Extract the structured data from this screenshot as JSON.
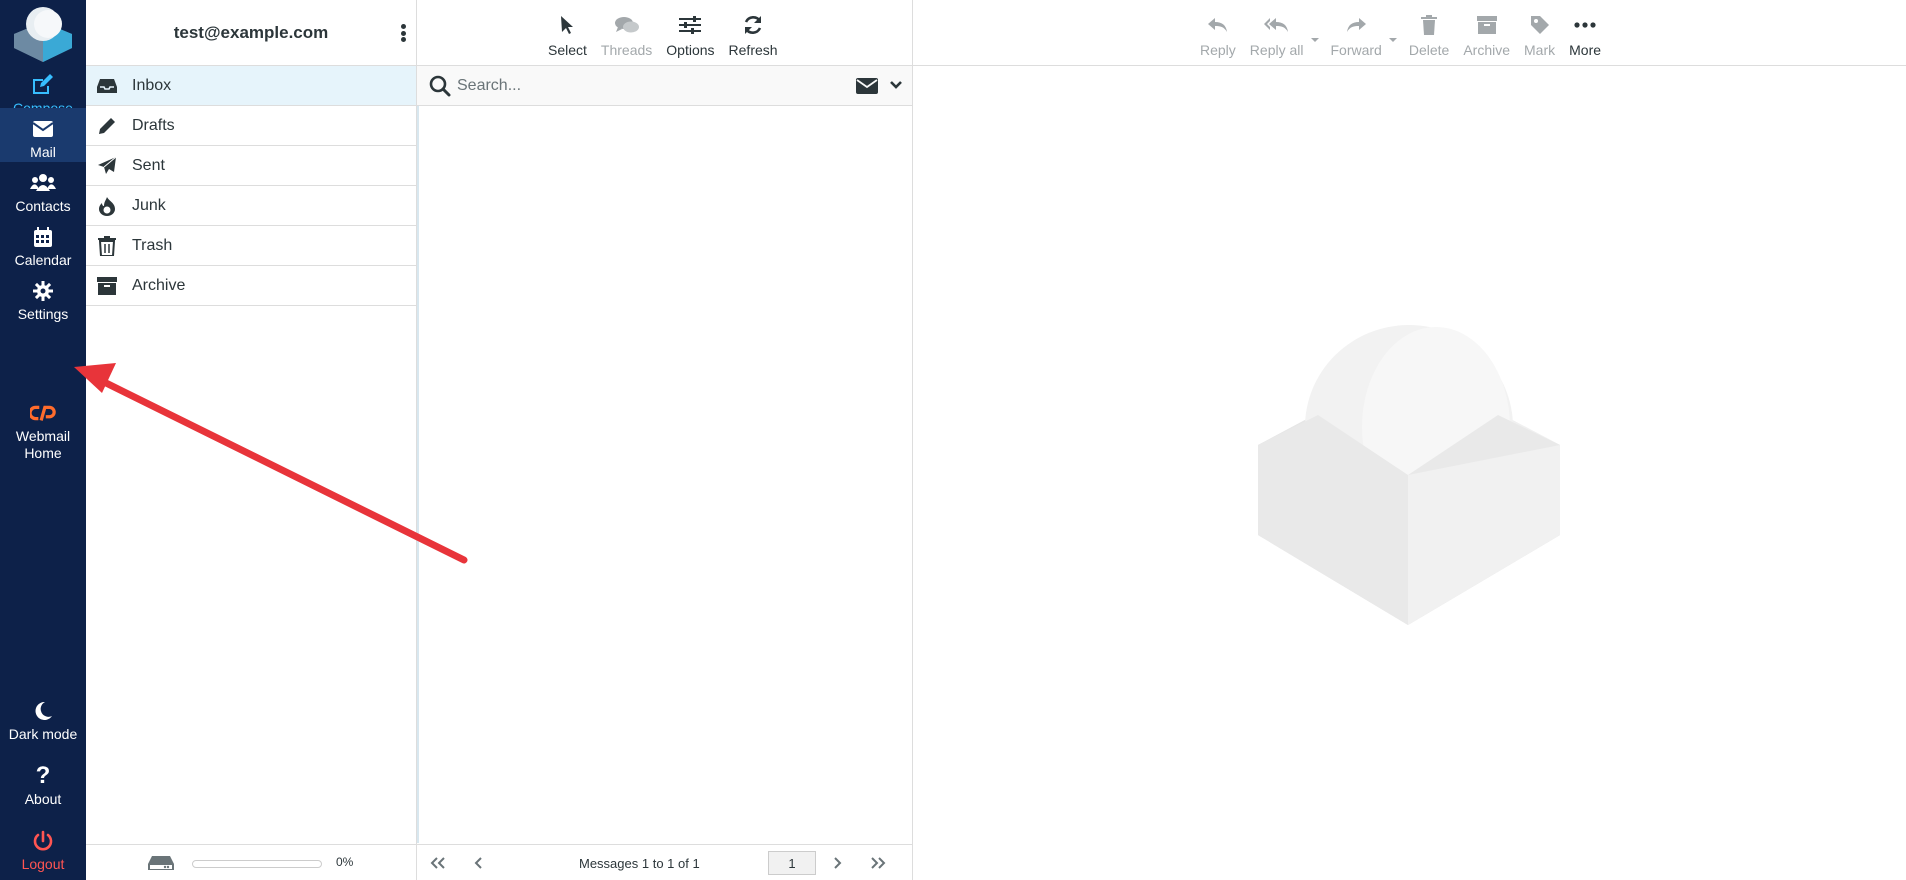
{
  "nav": {
    "compose": "Compose",
    "mail": "Mail",
    "contacts": "Contacts",
    "calendar": "Calendar",
    "settings": "Settings",
    "webmail_home": "Webmail Home",
    "dark_mode": "Dark mode",
    "about": "About",
    "logout": "Logout"
  },
  "account": {
    "email": "test@example.com"
  },
  "folders": [
    {
      "label": "Inbox",
      "icon": "inbox-icon",
      "selected": true
    },
    {
      "label": "Drafts",
      "icon": "pencil-icon"
    },
    {
      "label": "Sent",
      "icon": "paper-plane-icon"
    },
    {
      "label": "Junk",
      "icon": "fire-icon"
    },
    {
      "label": "Trash",
      "icon": "trash-icon"
    },
    {
      "label": "Archive",
      "icon": "archive-box-icon"
    }
  ],
  "quota": {
    "text": "0%",
    "fraction": 0
  },
  "list_toolbar": {
    "select": "Select",
    "threads": "Threads",
    "options": "Options",
    "refresh": "Refresh"
  },
  "search": {
    "placeholder": "Search..."
  },
  "list_footer": {
    "count_text": "Messages 1 to 1 of 1",
    "page": "1"
  },
  "preview_toolbar": {
    "reply": "Reply",
    "reply_all": "Reply all",
    "forward": "Forward",
    "delete": "Delete",
    "archive": "Archive",
    "mark": "Mark",
    "more": "More"
  },
  "colors": {
    "nav_bg": "#0d2149",
    "accent": "#37beff",
    "logout": "#ff5552",
    "arrow": "#e8343a"
  }
}
